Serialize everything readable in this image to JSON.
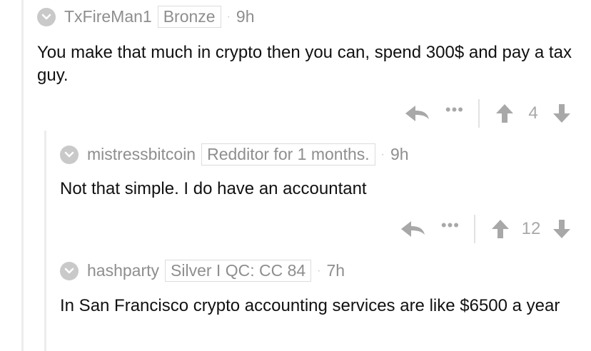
{
  "comments": [
    {
      "username": "TxFireMan1",
      "flair": "Bronze",
      "time": "9h",
      "body": "You make that much in crypto then you can, spend 300$ and pay a tax guy.",
      "score": "4"
    },
    {
      "username": "mistressbitcoin",
      "flair": "Redditor for 1 months.",
      "time": "9h",
      "body": "Not that simple. I do have an accountant",
      "score": "12"
    },
    {
      "username": "hashparty",
      "flair": "Silver I QC: CC 84",
      "time": "7h",
      "body": "In San Francisco crypto accounting services are like $6500 a year"
    }
  ],
  "separator": "·",
  "more_label": "•••",
  "icons": {
    "avatar": "chevron-down-icon",
    "reply": "reply-icon",
    "more": "more-icon",
    "upvote": "upvote-icon",
    "downvote": "downvote-icon"
  },
  "colors": {
    "text": "#111111",
    "meta": "#8e8e8e",
    "icon": "#a8a8a8",
    "thread_line": "#ededed"
  }
}
